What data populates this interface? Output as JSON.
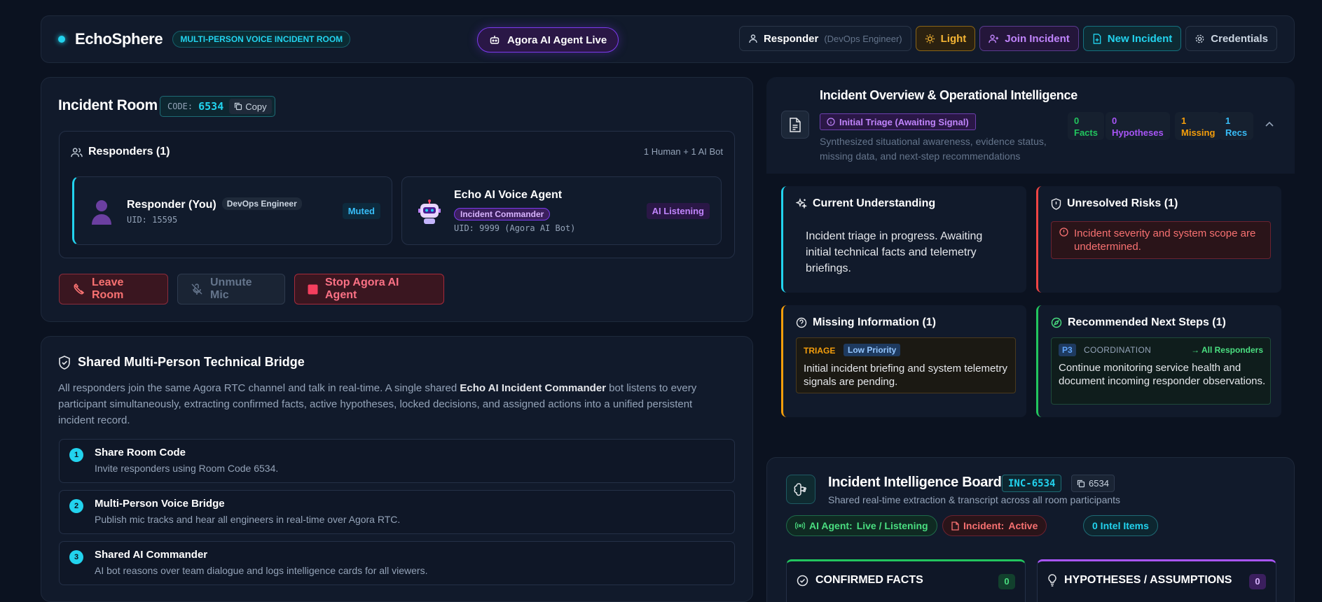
{
  "header": {
    "brand": "EchoSphere",
    "room_badge": "MULTI-PERSON VOICE INCIDENT ROOM",
    "agent_status": "Agora AI Agent Live",
    "user_label": "Responder",
    "user_role": "(DevOps Engineer)",
    "theme_button": "Light",
    "join_button": "Join Incident",
    "new_button": "New Incident",
    "credentials_button": "Credentials"
  },
  "room": {
    "title": "Incident Room",
    "code_label": "CODE:",
    "code": "6534",
    "copy_label": "Copy",
    "responders_title": "Responders (1)",
    "responders_summary": "1 Human + 1 AI Bot",
    "you": {
      "name": "Responder (You)",
      "role": "DevOps Engineer",
      "uid": "UID: 15595",
      "status": "Muted"
    },
    "bot": {
      "name": "Echo AI Voice Agent",
      "role": "Incident Commander",
      "uid": "UID: 9999 (Agora AI Bot)",
      "status": "AI Listening"
    },
    "actions": {
      "leave": "Leave Room",
      "unmute": "Unmute Mic",
      "stop": "Stop Agora AI Agent"
    }
  },
  "bridge": {
    "title": "Shared Multi-Person Technical Bridge",
    "desc_pre": "All responders join the same Agora RTC channel and talk in real-time. A single shared ",
    "desc_bold": "Echo AI Incident Commander",
    "desc_post": " bot listens to every participant simultaneously, extracting confirmed facts, active hypotheses, locked decisions, and assigned actions into a unified persistent incident record.",
    "steps": [
      {
        "num": "1",
        "title": "Share Room Code",
        "desc": "Invite responders using Room Code 6534."
      },
      {
        "num": "2",
        "title": "Multi-Person Voice Bridge",
        "desc": "Publish mic tracks and hear all engineers in real-time over Agora RTC."
      },
      {
        "num": "3",
        "title": "Shared AI Commander",
        "desc": "AI bot reasons over team dialogue and logs intelligence cards for all viewers."
      }
    ]
  },
  "overview": {
    "title": "Incident Overview & Operational Intelligence",
    "status": "Initial Triage (Awaiting Signal)",
    "desc": "Synthesized situational awareness, evidence status, missing data, and next-step recommendations",
    "stats": [
      {
        "value": "0",
        "label": "Facts",
        "color": "#22c55e"
      },
      {
        "value": "0",
        "label": "Hypotheses",
        "color": "#a855f7"
      },
      {
        "value": "1",
        "label": "Missing",
        "color": "#f59e0b"
      },
      {
        "value": "1",
        "label": "Recs",
        "color": "#38bdf8"
      }
    ],
    "understanding_title": "Current Understanding",
    "understanding_body": "Incident triage in progress. Awaiting initial technical facts and telemetry briefings.",
    "risks_title": "Unresolved Risks (1)",
    "risk_text": "Incident severity and system scope are undetermined.",
    "missing_title": "Missing Information (1)",
    "missing_tag": "TRIAGE",
    "missing_priority": "Low Priority",
    "missing_text": "Initial incident briefing and system telemetry signals are pending.",
    "recs_title": "Recommended Next Steps (1)",
    "rec_priority": "P3",
    "rec_category": "COORDINATION",
    "rec_assignee": "→ All Responders",
    "rec_text": "Continue monitoring service health and document incoming responder observations."
  },
  "board": {
    "title": "Incident Intelligence Board",
    "inc_id": "INC-6534",
    "code": "6534",
    "subtitle": "Shared real-time extraction & transcript across all room participants",
    "ai_label": "AI Agent:",
    "ai_value": "Live / Listening",
    "inc_label": "Incident:",
    "inc_value": "Active",
    "intel": "0 Intel Items",
    "facts_title": "CONFIRMED FACTS",
    "facts_count": "0",
    "hyp_title": "HYPOTHESES / ASSUMPTIONS",
    "hyp_count": "0"
  }
}
